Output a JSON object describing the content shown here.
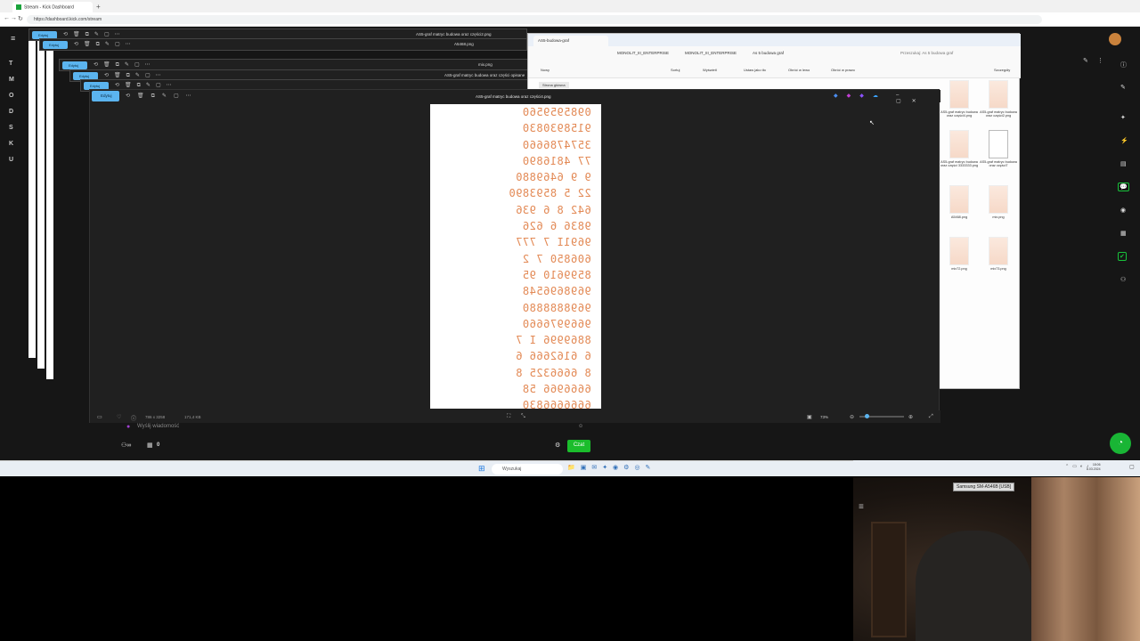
{
  "browser": {
    "tab_title": "Stream - Kick Dashboard",
    "new_tab": "+",
    "url": "https://dashboard.kick.com/stream",
    "nav_back": "←",
    "nav_forward": "→",
    "nav_reload": "↻"
  },
  "dashboard": {
    "sidebar_items": [
      "T",
      "M",
      "O",
      "D",
      "S",
      "K",
      "U"
    ],
    "chat_placeholder": "Wyślij wiadomość",
    "points_count": "0",
    "chat_button": "Czat"
  },
  "windows": {
    "back1_title": "AS5-graf matryc budowa oraz części2.png",
    "back2_title": "A5468.png",
    "back3_title": "mix.png",
    "back4_title": "AS5-graf matryc budowa oraz części opisane",
    "edit_label": "Edytuj"
  },
  "viewer": {
    "title": "AS5-graf matryc budowa oraz części4.png",
    "edit_label": "Edytuj",
    "status_dims": "786 x 3258",
    "status_size": "171,4 KB",
    "zoom": "73%",
    "digit_rows": [
      "0985959560",
      "9158930830",
      "3574786660",
      "77 4816890",
      "9 9 6469880",
      "22 5 8593890",
      "642 8 6 936",
      "9836 6 626",
      "9691I 7 777",
      "606850 7 2",
      "8599610 95",
      "9698696548",
      "9698888880",
      "9669976660",
      "8869996 I 7",
      "6 6162666 6",
      "8 6666325 8",
      "6666966 58",
      "6666666830"
    ]
  },
  "explorer": {
    "tab_title": "AS5-budowa-graf",
    "path": [
      "MONOLIT_III_ENTERPRISE",
      "MONOLIT_III_ENTERPRISE",
      "As 5 budowa graf"
    ],
    "search_placeholder": "Przeszukaj: As 5 budowa graf",
    "commands": [
      "Nowy",
      "Sortuj",
      "Wyświetl",
      "Ustaw jako tło",
      "Obróć w lewo",
      "Obróć w prawo",
      "Szczegóły"
    ],
    "nav_item": "Strona główna",
    "files": [
      {
        "name": "AS5-graf matryc budowa oraz części4.png",
        "white": false
      },
      {
        "name": "AS5-graf matryc budowa oraz części2.png",
        "white": false
      },
      {
        "name": "AS5-graf matryc budowa oraz części 3333333.png",
        "white": false
      },
      {
        "name": "AS5-graf matryc budowa oraz części7",
        "white": true
      },
      {
        "name": "A5468.png",
        "white": false
      },
      {
        "name": "mix.png",
        "white": false
      },
      {
        "name": "mix72.png",
        "white": false
      },
      {
        "name": "mix73.png",
        "white": false
      }
    ]
  },
  "taskbar": {
    "search_placeholder": "Wyszukaj",
    "time": "18:06",
    "date": "8.03.2024"
  },
  "webcam": {
    "label": "Samsung SM-A546B [USB]"
  }
}
